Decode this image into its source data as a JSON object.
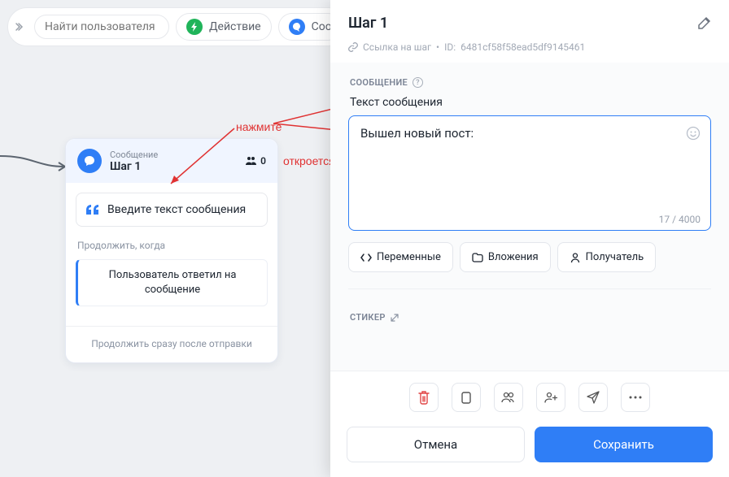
{
  "topbar": {
    "search_placeholder": "Найти пользователя",
    "action_label": "Действие",
    "message_label": "Сооб"
  },
  "card": {
    "type_label": "Сообщение",
    "title": "Шаг 1",
    "user_count": "0",
    "input_placeholder": "Введите текст сообщения",
    "continue_label": "Продолжить, когда",
    "continue_option": "Пользователь ответил на сообщение",
    "footer": "Продолжить сразу после отправки"
  },
  "annotations": {
    "press": "нажмите",
    "opens": "откроется окно для редактирования блока"
  },
  "panel": {
    "title": "Шаг 1",
    "link_label": "Ссылка на шаг",
    "id_prefix": "ID:",
    "id_value": "6481cf58f58ead5df9145461",
    "section_message": "СООБЩЕНИЕ",
    "text_label": "Текст сообщения",
    "message_value": "Вышел новый пост:",
    "char_counter": "17 / 4000",
    "btn_variables": "Переменные",
    "btn_attachments": "Вложения",
    "btn_recipient": "Получатель",
    "section_sticker": "СТИКЕР",
    "cancel": "Отмена",
    "save": "Сохранить"
  }
}
